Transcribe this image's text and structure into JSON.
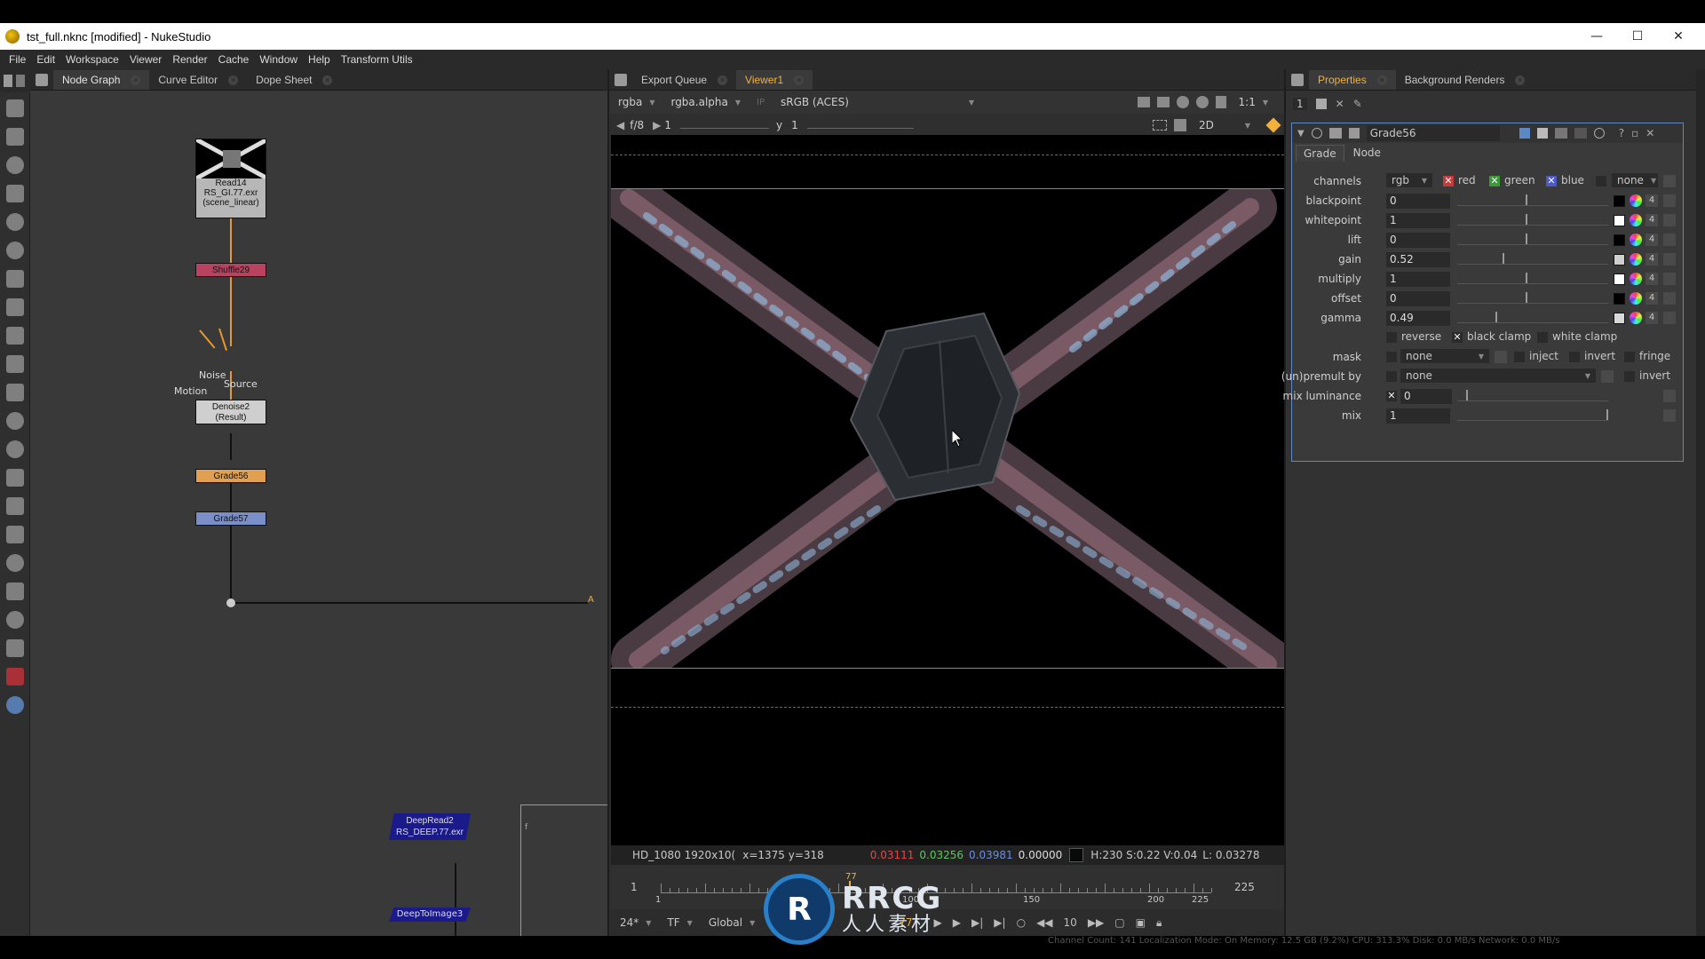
{
  "window": {
    "title": "tst_full.nknc [modified] - NukeStudio",
    "minimize": "—",
    "maximize": "☐",
    "close": "✕"
  },
  "menu": [
    "File",
    "Edit",
    "Workspace",
    "Viewer",
    "Render",
    "Cache",
    "Window",
    "Help",
    "Transform Utils"
  ],
  "left_tabs": [
    "Node Graph",
    "Curve Editor",
    "Dope Sheet"
  ],
  "viewer_tabs": [
    "Export Queue",
    "Viewer1"
  ],
  "right_tabs": [
    "Properties",
    "Background Renders"
  ],
  "viewer": {
    "channels": "rgba",
    "alpha_channel": "rgba.alpha",
    "ip": "IP",
    "colorspace": "sRGB (ACES)",
    "zoom": "1:1",
    "fstop": "f/8",
    "frame_increment": "1",
    "y_label": "y",
    "y_value": "1",
    "view_mode": "2D",
    "info": {
      "format": "HD_1080 1920x10(",
      "coords": "x=1375 y=318",
      "r": "0.03111",
      "g": "0.03256",
      "b": "0.03981",
      "a": "0.00000",
      "hsv": "H:230 S:0.22 V:0.04",
      "lum": "L: 0.03278"
    },
    "timeline": {
      "start": "1",
      "end": "225",
      "ticks": [
        "1",
        "50",
        "100",
        "150",
        "200",
        "225"
      ],
      "current": "77"
    },
    "playback": {
      "fps": "24*",
      "tf": "TF",
      "scope": "Global",
      "frame": "77",
      "step": "10"
    }
  },
  "nodes": {
    "read": {
      "line1": "Read14",
      "line2": "RS_GI.77.exr",
      "line3": "(scene_linear)"
    },
    "shuffle": "Shuffle29",
    "denoise": {
      "line1": "Denoise2",
      "line2": "(Result)"
    },
    "denoise_inputs": {
      "noise": "Noise",
      "source": "Source",
      "motion": "Motion"
    },
    "grade56": "Grade56",
    "grade57": "Grade57",
    "deepread": {
      "line1": "DeepRead2",
      "line2": "RS_DEEP.77.exr"
    },
    "deeptoimage": "DeepToImage3",
    "input_a": "A",
    "minimap_label": "f"
  },
  "properties": {
    "stack_count": "1",
    "node_name": "Grade56",
    "tabs": [
      "Grade",
      "Node"
    ],
    "channels_label": "channels",
    "channels": "rgb",
    "red": "red",
    "green": "green",
    "blue": "blue",
    "alpha_none": "none",
    "params": [
      {
        "label": "blackpoint",
        "value": "0",
        "knob": 0.45,
        "swatch": "#000000"
      },
      {
        "label": "whitepoint",
        "value": "1",
        "knob": 0.45,
        "swatch": "#ffffff"
      },
      {
        "label": "lift",
        "value": "0",
        "knob": 0.45,
        "swatch": "#000000"
      },
      {
        "label": "gain",
        "value": "0.52",
        "knob": 0.3,
        "swatch": "#cfcfcf"
      },
      {
        "label": "multiply",
        "value": "1",
        "knob": 0.45,
        "swatch": "#ffffff"
      },
      {
        "label": "offset",
        "value": "0",
        "knob": 0.45,
        "swatch": "#000000"
      },
      {
        "label": "gamma",
        "value": "0.49",
        "knob": 0.25,
        "swatch": "#d8d8d8"
      }
    ],
    "reverse": "reverse",
    "black_clamp": "black clamp",
    "white_clamp": "white clamp",
    "mask_label": "mask",
    "mask_value": "none",
    "inject": "inject",
    "invert": "invert",
    "fringe": "fringe",
    "unpremult_label": "(un)premult by",
    "unpremult_value": "none",
    "unpremult_invert": "invert",
    "mix_luminance_label": "mix luminance",
    "mix_luminance_value": "0",
    "mix_label": "mix",
    "mix_value": "1",
    "channel_count": "4"
  },
  "watermark": {
    "text": "RRCG",
    "subtitle": "人人素材"
  },
  "status_text": "Channel Count: 141  Localization Mode: On  Memory: 12.5 GB (9.2%)  CPU: 313.3%  Disk: 0.0 MB/s  Network: 0.0 MB/s",
  "colors": {
    "accent": "#f1b13a",
    "selection": "#5c88c6",
    "shuffle_node": "#b8425f",
    "grade56_node": "#e0a050",
    "grade57_node": "#7a8fc8",
    "deep_node": "#1a1a8a"
  }
}
